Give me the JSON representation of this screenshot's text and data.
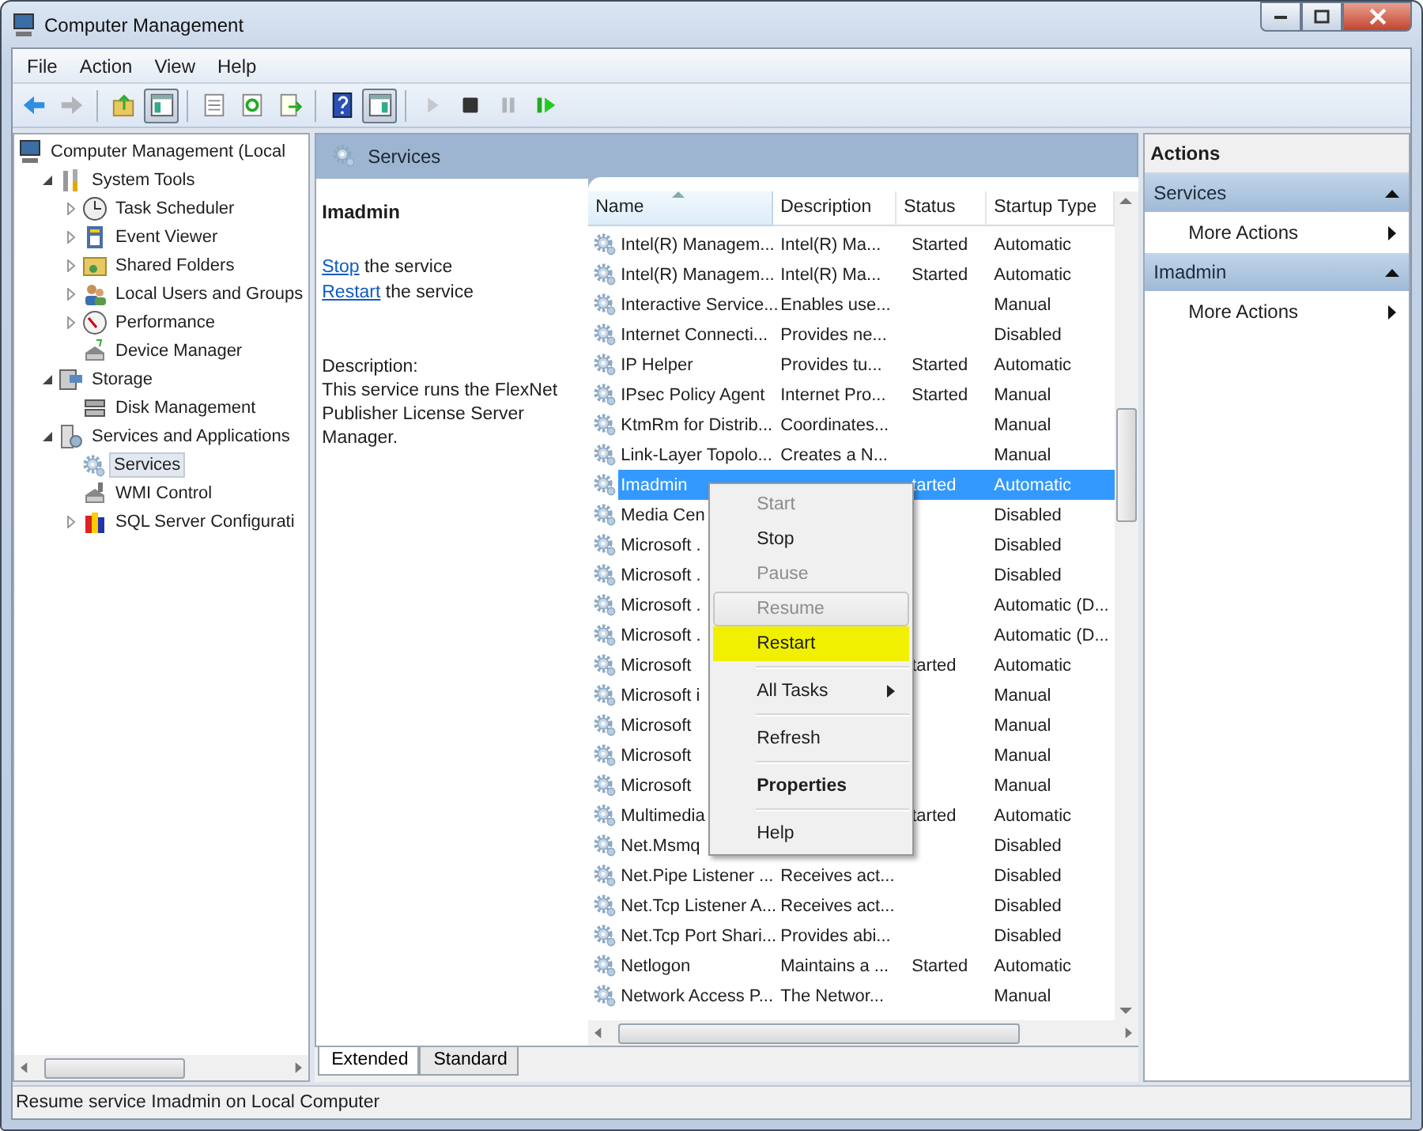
{
  "window": {
    "title": "Computer Management"
  },
  "menu": [
    "File",
    "Action",
    "View",
    "Help"
  ],
  "toolbar": [
    {
      "pressed": false,
      "disabled": false
    },
    {
      "pressed": false,
      "disabled": true
    },
    {
      "pressed": false,
      "disabled": false
    },
    {
      "pressed": true,
      "disabled": false
    },
    {
      "pressed": false,
      "disabled": false
    },
    {
      "pressed": false,
      "disabled": false
    },
    {
      "pressed": false,
      "disabled": false
    },
    {
      "pressed": false,
      "disabled": false
    },
    {
      "pressed": true,
      "disabled": false
    },
    {
      "pressed": false,
      "disabled": true
    },
    {
      "pressed": false,
      "disabled": false
    },
    {
      "pressed": false,
      "disabled": true
    },
    {
      "pressed": false,
      "disabled": false
    }
  ],
  "tree": [
    {
      "label": "Computer Management (Local",
      "selected": false,
      "children": [
        {
          "label": "System Tools",
          "expanded": true,
          "selected": false,
          "children": [
            {
              "label": "Task Scheduler",
              "expanded": false,
              "selected": false
            },
            {
              "label": "Event Viewer",
              "expanded": false,
              "selected": false
            },
            {
              "label": "Shared Folders",
              "expanded": false,
              "selected": false
            },
            {
              "label": "Local Users and Groups",
              "expanded": false,
              "selected": false
            },
            {
              "label": "Performance",
              "expanded": false,
              "selected": false
            },
            {
              "label": "Device Manager",
              "selected": false
            }
          ]
        },
        {
          "label": "Storage",
          "expanded": true,
          "selected": false,
          "children": [
            {
              "label": "Disk Management",
              "selected": false
            }
          ]
        },
        {
          "label": "Services and Applications",
          "expanded": true,
          "selected": false,
          "children": [
            {
              "label": "Services",
              "selected": true
            },
            {
              "label": "WMI Control",
              "selected": false
            },
            {
              "label": "SQL Server Configurati",
              "expanded": false,
              "selected": false
            }
          ]
        }
      ]
    }
  ],
  "pane_header": "Services",
  "details": {
    "title": "Imadmin",
    "actions": [
      {
        "link": "Stop",
        "text": "the service"
      },
      {
        "link": "Restart",
        "text": "the service"
      }
    ],
    "description_label": "Description:",
    "description": "This service runs the FlexNet Publisher License Server Manager."
  },
  "table": {
    "columns": [
      "Name",
      "Description",
      "Status",
      "Startup Type"
    ],
    "rows": [
      {
        "name": "Intel(R) Managem...",
        "description": "Intel(R) Ma...",
        "status": "Started",
        "startup": "Automatic",
        "selected": false
      },
      {
        "name": "Intel(R) Managem...",
        "description": "Intel(R) Ma...",
        "status": "Started",
        "startup": "Automatic",
        "selected": false
      },
      {
        "name": "Interactive Service...",
        "description": "Enables use...",
        "startup": "Manual",
        "selected": false
      },
      {
        "name": "Internet Connecti...",
        "description": "Provides ne...",
        "startup": "Disabled",
        "selected": false
      },
      {
        "name": "IP Helper",
        "description": "Provides tu...",
        "status": "Started",
        "startup": "Automatic",
        "selected": false
      },
      {
        "name": "IPsec Policy Agent",
        "description": "Internet Pro...",
        "status": "Started",
        "startup": "Manual",
        "selected": false
      },
      {
        "name": "KtmRm for Distrib...",
        "description": "Coordinates...",
        "startup": "Manual",
        "selected": false
      },
      {
        "name": "Link-Layer Topolo...",
        "description": "Creates a N...",
        "startup": "Manual",
        "selected": false
      },
      {
        "name": "Imadmin",
        "status": "tarted",
        "startup": "Automatic",
        "selected": true
      },
      {
        "name": "Media Cen",
        "startup": "Disabled",
        "selected": false
      },
      {
        "name": "Microsoft .",
        "startup": "Disabled",
        "selected": false
      },
      {
        "name": "Microsoft .",
        "startup": "Disabled",
        "selected": false
      },
      {
        "name": "Microsoft .",
        "startup": "Automatic (D...",
        "selected": false
      },
      {
        "name": "Microsoft .",
        "startup": "Automatic (D...",
        "selected": false
      },
      {
        "name": "Microsoft",
        "status": "tarted",
        "startup": "Automatic",
        "selected": false
      },
      {
        "name": "Microsoft i",
        "startup": "Manual",
        "selected": false
      },
      {
        "name": "Microsoft",
        "startup": "Manual",
        "selected": false
      },
      {
        "name": "Microsoft",
        "startup": "Manual",
        "selected": false
      },
      {
        "name": "Microsoft",
        "startup": "Manual",
        "selected": false
      },
      {
        "name": "Multimedia",
        "status": "tarted",
        "startup": "Automatic",
        "selected": false
      },
      {
        "name": "Net.Msmq",
        "startup": "Disabled",
        "selected": false
      },
      {
        "name": "Net.Pipe Listener ...",
        "description": "Receives act...",
        "startup": "Disabled",
        "selected": false
      },
      {
        "name": "Net.Tcp Listener A...",
        "description": "Receives act...",
        "startup": "Disabled",
        "selected": false
      },
      {
        "name": "Net.Tcp Port Shari...",
        "description": "Provides abi...",
        "startup": "Disabled",
        "selected": false
      },
      {
        "name": "Netlogon",
        "description": "Maintains a ...",
        "status": "Started",
        "startup": "Automatic",
        "selected": false
      },
      {
        "name": "Network Access P...",
        "description": "The Networ...",
        "startup": "Manual",
        "selected": false
      }
    ]
  },
  "context_menu": [
    {
      "kind": "item",
      "label": "Start",
      "disabled": true,
      "selected": false,
      "highlighted": false,
      "default": false
    },
    {
      "kind": "item",
      "label": "Stop",
      "disabled": false,
      "selected": false,
      "highlighted": false,
      "default": false
    },
    {
      "kind": "item",
      "label": "Pause",
      "disabled": true,
      "selected": false,
      "highlighted": false,
      "default": false
    },
    {
      "kind": "item",
      "label": "Resume",
      "disabled": true,
      "selected": true,
      "highlighted": false,
      "default": false
    },
    {
      "kind": "item",
      "label": "Restart",
      "disabled": false,
      "selected": false,
      "highlighted": true,
      "default": false
    },
    {
      "kind": "separator"
    },
    {
      "kind": "submenu",
      "label": "All Tasks",
      "disabled": false,
      "selected": false,
      "highlighted": false,
      "default": false
    },
    {
      "kind": "separator"
    },
    {
      "kind": "item",
      "label": "Refresh",
      "disabled": false,
      "selected": false,
      "highlighted": false,
      "default": false
    },
    {
      "kind": "separator"
    },
    {
      "kind": "item",
      "label": "Properties",
      "disabled": false,
      "selected": false,
      "highlighted": false,
      "default": true
    },
    {
      "kind": "separator"
    },
    {
      "kind": "item",
      "label": "Help",
      "disabled": false,
      "selected": false,
      "highlighted": false,
      "default": false
    }
  ],
  "view_tabs": [
    {
      "label": "Extended",
      "selected": true
    },
    {
      "label": "Standard",
      "selected": false
    }
  ],
  "actions": {
    "title": "Actions",
    "sections": [
      {
        "title": "Services",
        "items": [
          "More Actions"
        ]
      },
      {
        "title": "Imadmin",
        "items": [
          "More Actions"
        ]
      }
    ]
  },
  "status_bar": "Resume service Imadmin on Local Computer"
}
